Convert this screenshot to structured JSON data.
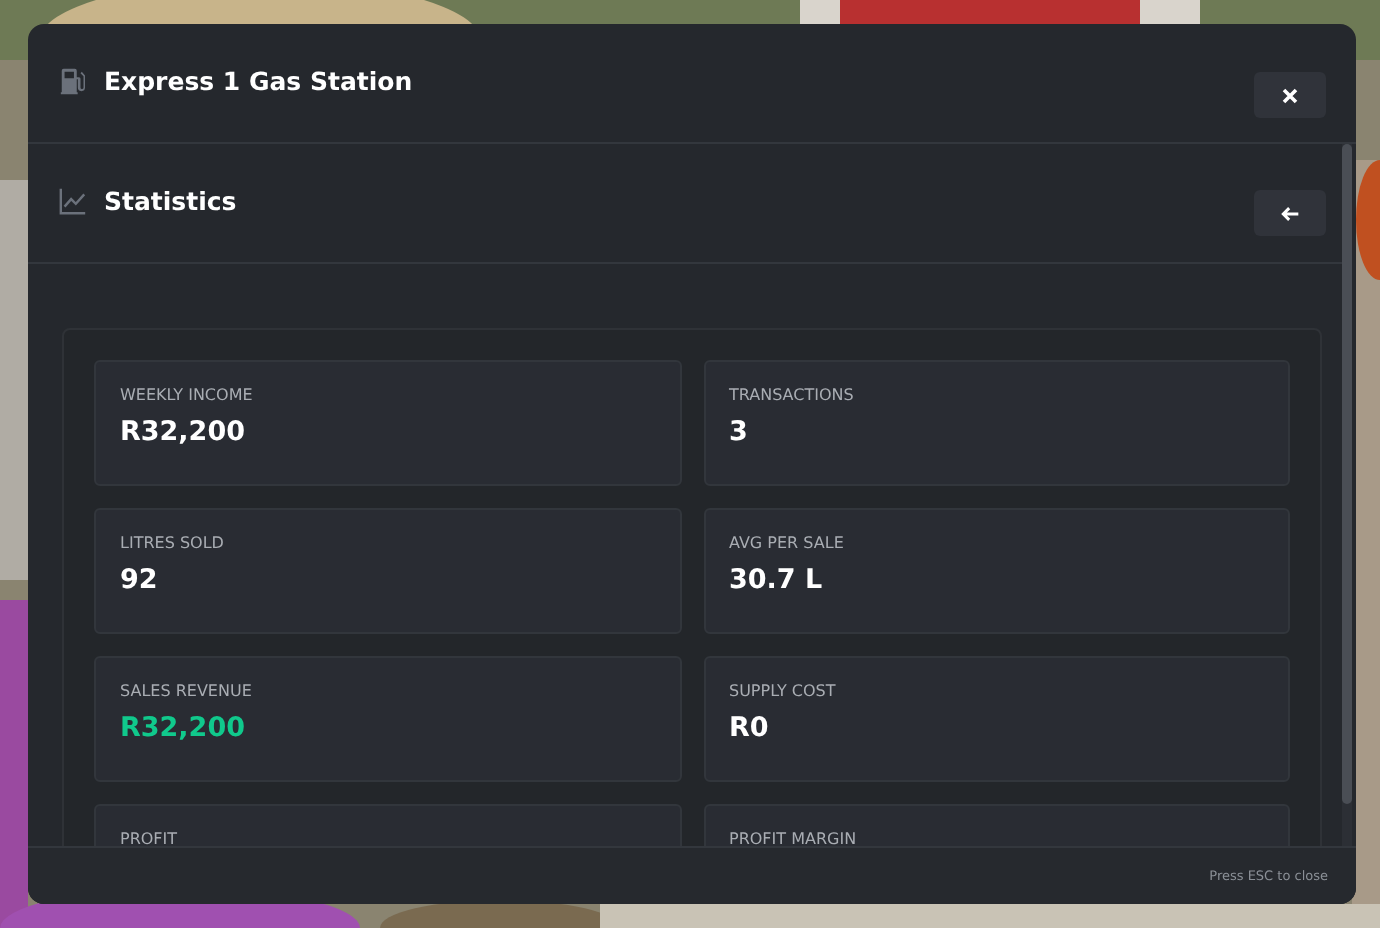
{
  "window": {
    "title": "Express 1 Gas Station"
  },
  "section": {
    "title": "Statistics"
  },
  "stats": [
    {
      "label": "WEEKLY INCOME",
      "value": "R32,200",
      "color": "#ffffff"
    },
    {
      "label": "TRANSACTIONS",
      "value": "3",
      "color": "#ffffff"
    },
    {
      "label": "LITRES SOLD",
      "value": "92",
      "color": "#ffffff"
    },
    {
      "label": "AVG PER SALE",
      "value": "30.7 L",
      "color": "#ffffff"
    },
    {
      "label": "SALES REVENUE",
      "value": "R32,200",
      "color": "#10c98c"
    },
    {
      "label": "SUPPLY COST",
      "value": "R0",
      "color": "#ffffff"
    },
    {
      "label": "PROFIT"
    },
    {
      "label": "PROFIT MARGIN"
    }
  ],
  "footer": {
    "hint": "Press ESC to close"
  }
}
